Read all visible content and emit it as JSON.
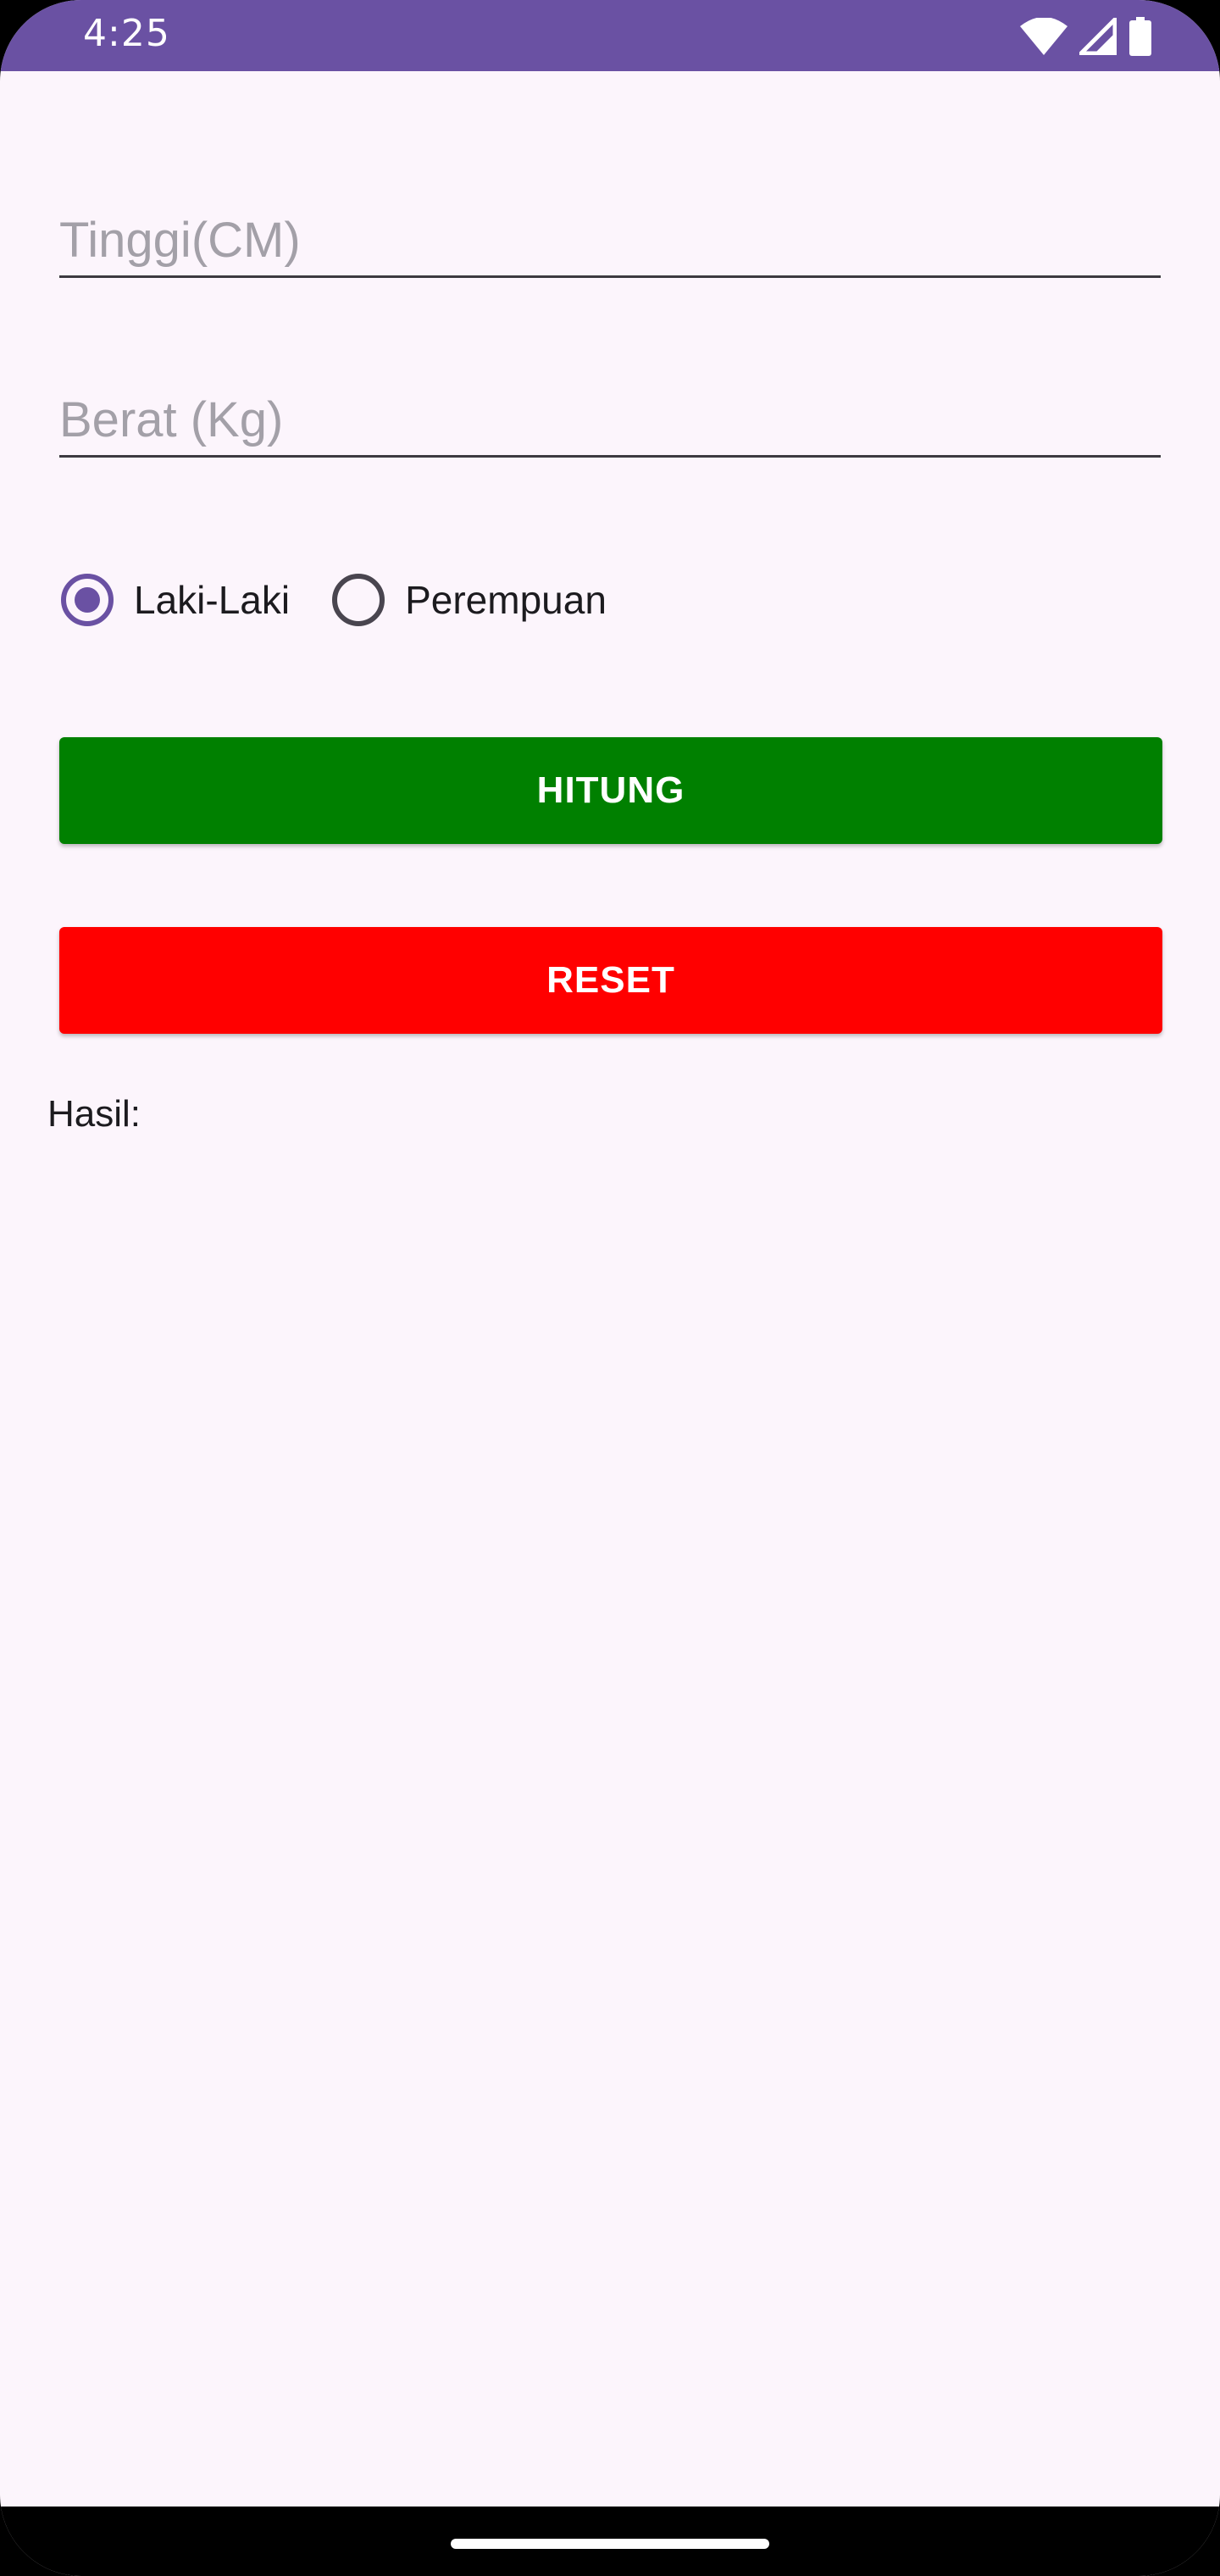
{
  "status_bar": {
    "time": "4:25",
    "background_color": "#6a51a3",
    "icons": [
      "wifi-icon",
      "signal-icon",
      "battery-icon"
    ]
  },
  "form": {
    "height_field": {
      "placeholder": "Tinggi(CM)",
      "value": ""
    },
    "weight_field": {
      "placeholder": "Berat (Kg)",
      "value": ""
    },
    "gender": {
      "options": [
        {
          "label": "Laki-Laki",
          "checked": true
        },
        {
          "label": "Perempuan",
          "checked": false
        }
      ],
      "accent_color": "#6a51a3"
    },
    "hitung_button": {
      "label": "HITUNG",
      "color": "#008000"
    },
    "reset_button": {
      "label": "RESET",
      "color": "#ff0000"
    },
    "result_label": "Hasil:"
  },
  "nav_bar": {
    "handle": "home-handle"
  }
}
